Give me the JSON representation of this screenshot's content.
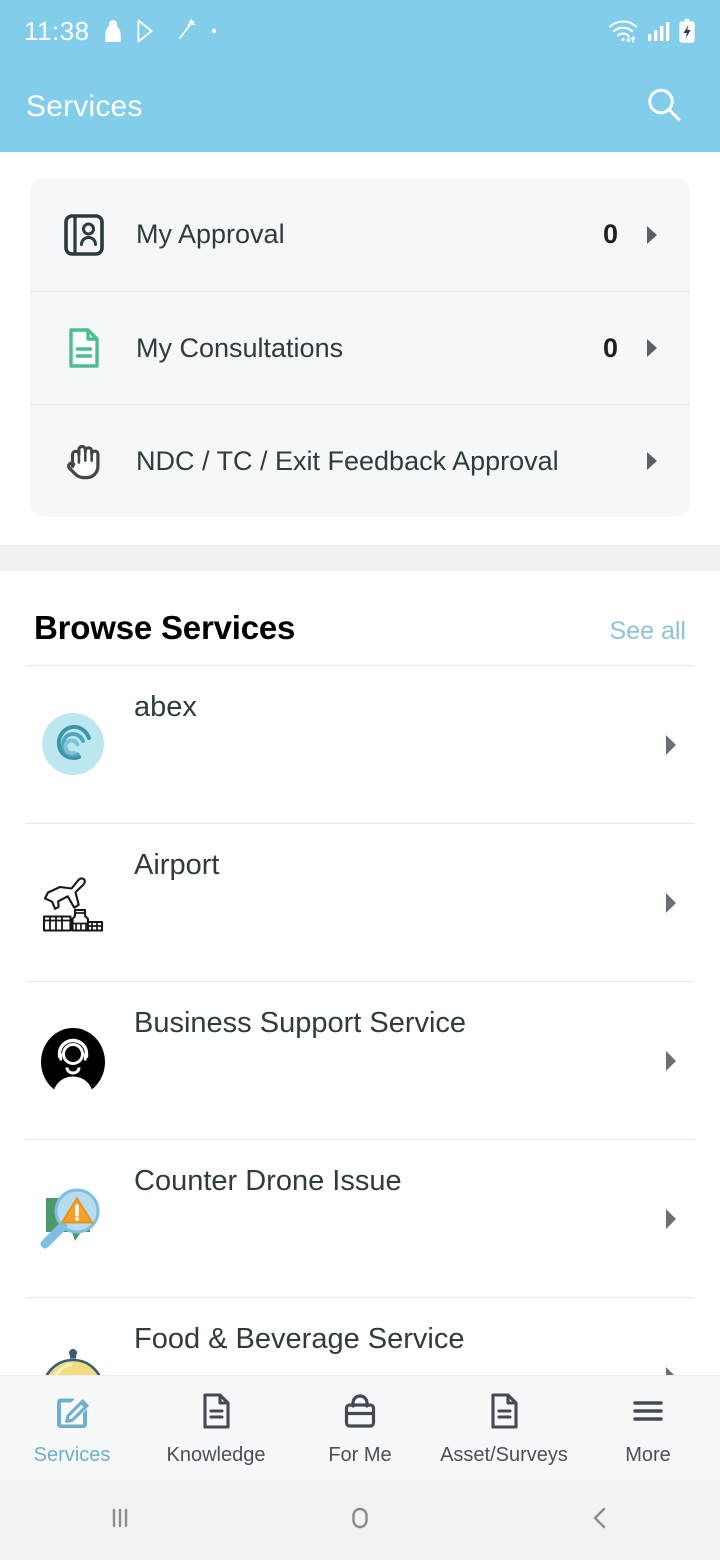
{
  "status_bar": {
    "time": "11:38",
    "left_icons": [
      "person-lock-icon",
      "google-play-icon",
      "magic-wand-icon",
      "dot-icon"
    ],
    "right_icons": [
      "wifi-icon",
      "cellular-signal-icon",
      "battery-charging-icon"
    ]
  },
  "app_bar": {
    "title": "Services",
    "search_icon": "search-icon",
    "background": "#82CDEA"
  },
  "approval_card": {
    "rows": [
      {
        "icon": "id-badge-icon",
        "label": "My Approval",
        "count": "0",
        "chevron": "chevron-right-icon"
      },
      {
        "icon": "document-green-icon",
        "label": "My Consultations",
        "count": "0",
        "chevron": "chevron-right-icon"
      },
      {
        "icon": "hand-icon",
        "label": "NDC / TC / Exit Feedback Approval",
        "count": "",
        "chevron": "chevron-right-icon"
      }
    ]
  },
  "browse": {
    "title": "Browse Services",
    "see_all": "See all",
    "see_all_color": "#8FC2DA",
    "items": [
      {
        "icon": "abex-swirl-icon",
        "label": "abex",
        "chevron": "chevron-right-icon"
      },
      {
        "icon": "airport-plane-icon",
        "label": "Airport",
        "chevron": "chevron-right-icon"
      },
      {
        "icon": "support-agent-icon",
        "label": "Business Support Service",
        "chevron": "chevron-right-icon"
      },
      {
        "icon": "drone-warning-icon",
        "label": "Counter Drone Issue",
        "chevron": "chevron-right-icon"
      },
      {
        "icon": "food-cloche-icon",
        "label": "Food & Beverage Service",
        "chevron": "chevron-right-icon"
      }
    ]
  },
  "bottom_nav": {
    "active_color": "#6FAFC9",
    "items": [
      {
        "icon": "edit-note-icon",
        "label": "Services",
        "active": true
      },
      {
        "icon": "document-icon",
        "label": "Knowledge",
        "active": false
      },
      {
        "icon": "briefcase-icon",
        "label": "For Me",
        "active": false
      },
      {
        "icon": "survey-document-icon",
        "label": "Asset/Surveys",
        "active": false
      },
      {
        "icon": "hamburger-menu-icon",
        "label": "More",
        "active": false
      }
    ]
  },
  "system_nav": {
    "buttons": [
      "recents-icon",
      "home-icon",
      "back-icon"
    ]
  }
}
